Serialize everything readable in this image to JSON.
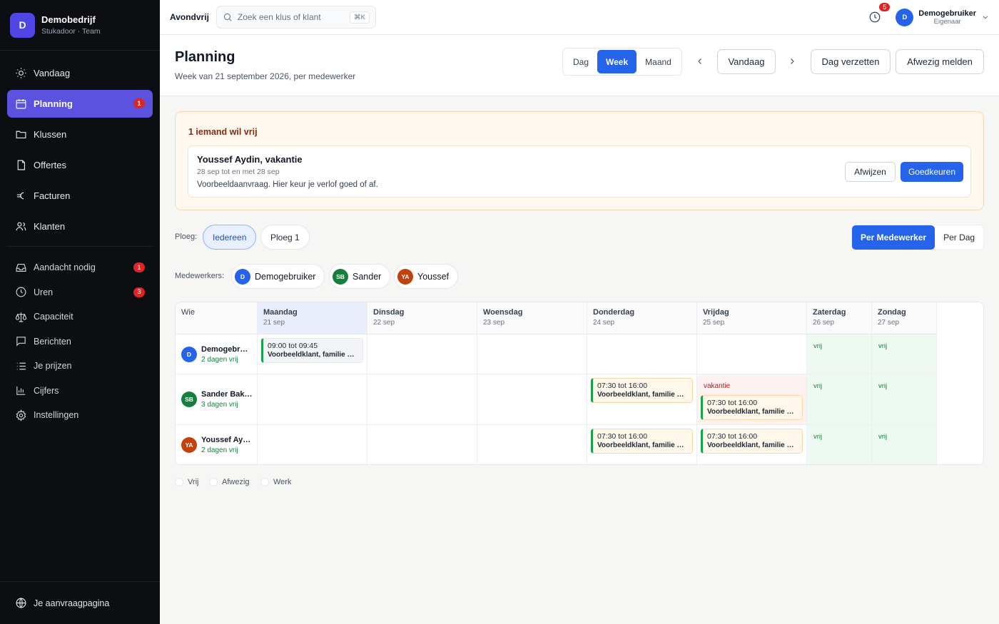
{
  "brand": {
    "initial": "D",
    "name": "Demobedrijf",
    "sub": "Stukadoor · Team"
  },
  "nav_main": [
    {
      "label": "Vandaag",
      "icon": "sun-icon"
    },
    {
      "label": "Planning",
      "icon": "calendar-icon",
      "badge": "1",
      "active": true
    },
    {
      "label": "Klussen",
      "icon": "folder-icon"
    },
    {
      "label": "Offertes",
      "icon": "file-icon"
    },
    {
      "label": "Facturen",
      "icon": "euro-icon"
    },
    {
      "label": "Klanten",
      "icon": "users-icon"
    }
  ],
  "nav_sub": [
    {
      "label": "Aandacht nodig",
      "icon": "inbox-icon",
      "badge": "1"
    },
    {
      "label": "Uren",
      "icon": "clock-icon",
      "badge": "3"
    },
    {
      "label": "Capaciteit",
      "icon": "scale-icon"
    },
    {
      "label": "Berichten",
      "icon": "chat-icon"
    },
    {
      "label": "Je prijzen",
      "icon": "list-icon"
    },
    {
      "label": "Cijfers",
      "icon": "bar-chart-icon"
    },
    {
      "label": "Instellingen",
      "icon": "gear-icon"
    }
  ],
  "nav_bottom": {
    "label": "Je aanvraagpagina",
    "icon": "globe-icon"
  },
  "topbar": {
    "app_name": "Avondvrij",
    "search_placeholder": "Zoek een klus of klant",
    "shortcut": "⌘K",
    "notif_count": "5",
    "user_initial": "D",
    "user_name": "Demogebruiker",
    "user_role": "Eigenaar"
  },
  "header": {
    "title": "Planning",
    "subtitle": "Week van 21 september 2026, per medewerker",
    "views": [
      "Dag",
      "Week",
      "Maand"
    ],
    "active_view": "Week",
    "today_label": "Vandaag",
    "move_day_label": "Dag verzetten",
    "report_absent_label": "Afwezig melden"
  },
  "request": {
    "title": "1 iemand wil vrij",
    "name": "Youssef Aydin, vakantie",
    "dates": "28 sep tot en met 28 sep",
    "note": "Voorbeeldaanvraag. Hier keur je verlof goed of af.",
    "reject_label": "Afwijzen",
    "approve_label": "Goedkeuren"
  },
  "filters": {
    "crew_label": "Ploeg:",
    "crews": [
      "Iedereen",
      "Ploeg 1"
    ],
    "active_crew": "Iedereen",
    "view_modes": [
      "Per Medewerker",
      "Per Dag"
    ],
    "active_view_mode": "Per Medewerker",
    "employees_label": "Medewerkers:",
    "employees": [
      {
        "initials": "D",
        "name": "Demogebruiker",
        "color": "#2563eb"
      },
      {
        "initials": "SB",
        "name": "Sander",
        "color": "#15803d"
      },
      {
        "initials": "YA",
        "name": "Youssef",
        "color": "#c2410c"
      }
    ]
  },
  "schedule": {
    "who_header": "Wie",
    "days": [
      {
        "day": "Maandag",
        "date": "21 sep",
        "today": true
      },
      {
        "day": "Dinsdag",
        "date": "22 sep"
      },
      {
        "day": "Woensdag",
        "date": "23 sep"
      },
      {
        "day": "Donderdag",
        "date": "24 sep"
      },
      {
        "day": "Vrijdag",
        "date": "25 sep"
      },
      {
        "day": "Zaterdag",
        "date": "26 sep",
        "weekend": true
      },
      {
        "day": "Zondag",
        "date": "27 sep",
        "weekend": true
      }
    ],
    "rows": [
      {
        "initials": "D",
        "color": "#2563eb",
        "name": "Demogebruiker",
        "free_days": "2 dagen vrij",
        "cells": [
          {
            "shifts": [
              {
                "time": "09:00 tot 09:45",
                "client": "Voorbeeldklant, familie De Vries"
              }
            ]
          },
          {},
          {},
          {},
          {},
          {
            "free": "vrij"
          },
          {
            "free": "vrij"
          }
        ]
      },
      {
        "initials": "SB",
        "color": "#15803d",
        "name": "Sander Bakker",
        "free_days": "3 dagen vrij",
        "cells": [
          {},
          {},
          {},
          {
            "shifts": [
              {
                "time": "07:30 tot 16:00",
                "client": "Voorbeeldklant, familie De Vries"
              }
            ]
          },
          {
            "absence": "vakantie",
            "shifts": [
              {
                "time": "07:30 tot 16:00",
                "client": "Voorbeeldklant, familie De Vries"
              }
            ]
          },
          {
            "free": "vrij"
          },
          {
            "free": "vrij"
          }
        ]
      },
      {
        "initials": "YA",
        "color": "#c2410c",
        "name": "Youssef Aydin",
        "free_days": "2 dagen vrij",
        "cells": [
          {},
          {},
          {},
          {
            "shifts": [
              {
                "time": "07:30 tot 16:00",
                "client": "Voorbeeldklant, familie De Vries"
              }
            ]
          },
          {
            "shifts": [
              {
                "time": "07:30 tot 16:00",
                "client": "Voorbeeldklant, familie De Vries"
              }
            ]
          },
          {
            "free": "vrij"
          },
          {
            "free": "vrij"
          }
        ]
      }
    ]
  },
  "legend": [
    "Vrij",
    "Afwezig",
    "Werk"
  ]
}
